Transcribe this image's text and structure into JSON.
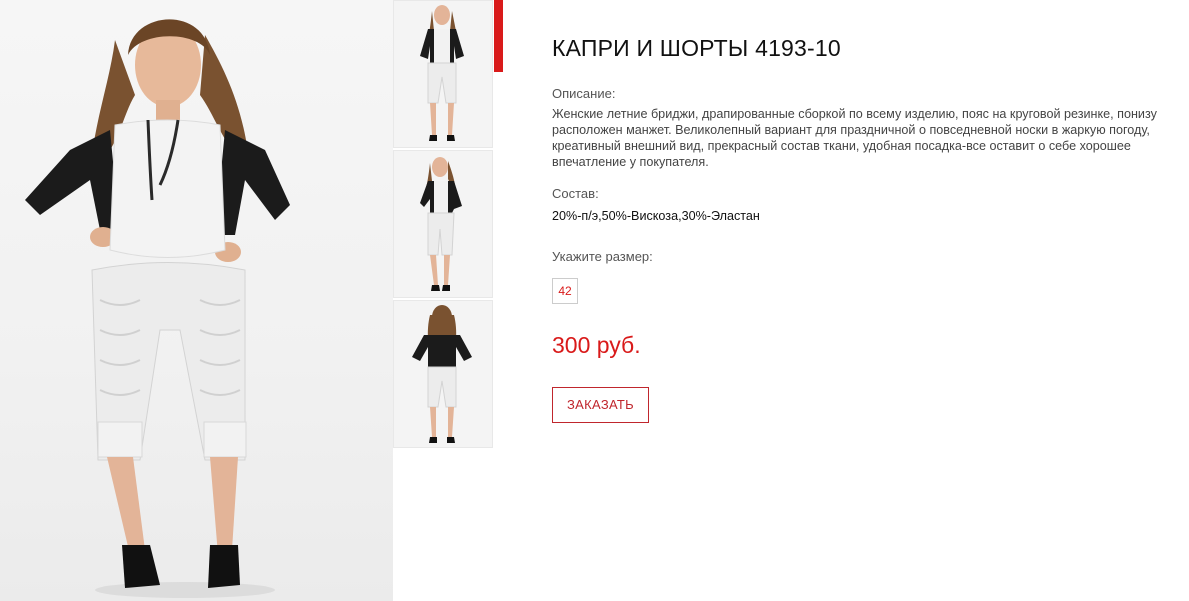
{
  "product": {
    "title": "КАПРИ И ШОРТЫ 4193-10",
    "description_label": "Описание:",
    "description": "Женские летние бриджи, драпированные сборкой по всему изделию, пояс на круговой резинке, понизу расположен манжет. Великолепный вариант для праздничной о повседневной носки в жаркую погоду, креативный внешний вид, прекрасный состав ткани, удобная посадка-все оставит о себе хорошее впечатление у покупателя.",
    "composition_label": "Состав:",
    "composition": "20%-п/э,50%-Вискоза,30%-Эластан",
    "size_label": "Укажите размер:",
    "sizes": [
      "42"
    ],
    "price": "300 руб.",
    "order_button": "ЗАКАЗАТЬ"
  },
  "gallery": {
    "main_photo": "model-front-photo",
    "thumbnails": [
      "thumb-front",
      "thumb-side",
      "thumb-back"
    ],
    "active_index": 0
  },
  "colors": {
    "accent": "#d91a1a",
    "text": "#333333",
    "jacket": "#1b1b1b",
    "garment": "#eeeeee"
  }
}
